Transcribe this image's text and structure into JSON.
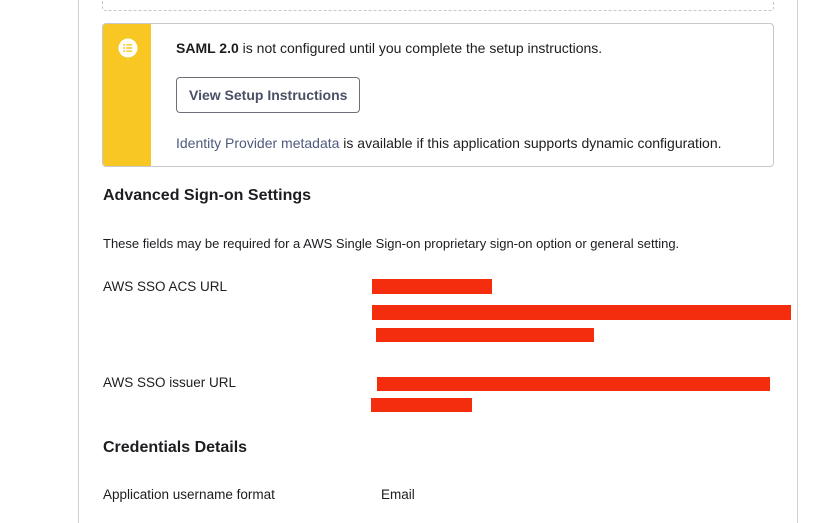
{
  "saml_callout": {
    "icon": "list-icon",
    "title_bold": "SAML 2.0",
    "title_rest": " is not configured until you complete the setup instructions.",
    "setup_button_label": "View Setup Instructions",
    "metadata_link": "Identity Provider metadata",
    "metadata_rest": " is available if this application supports dynamic configuration.",
    "accent_color": "#f8c724"
  },
  "advanced_settings": {
    "title": "Advanced Sign-on Settings",
    "description": "These fields may be required for a AWS Single Sign-on proprietary sign-on option or general setting.",
    "fields": [
      {
        "label": "AWS SSO ACS URL",
        "value_redacted": true
      },
      {
        "label": "AWS SSO issuer URL",
        "value_redacted": true
      }
    ]
  },
  "credentials": {
    "title": "Credentials Details",
    "fields": [
      {
        "label": "Application username format",
        "value": "Email"
      }
    ]
  },
  "redaction_color": "#f52d0f"
}
